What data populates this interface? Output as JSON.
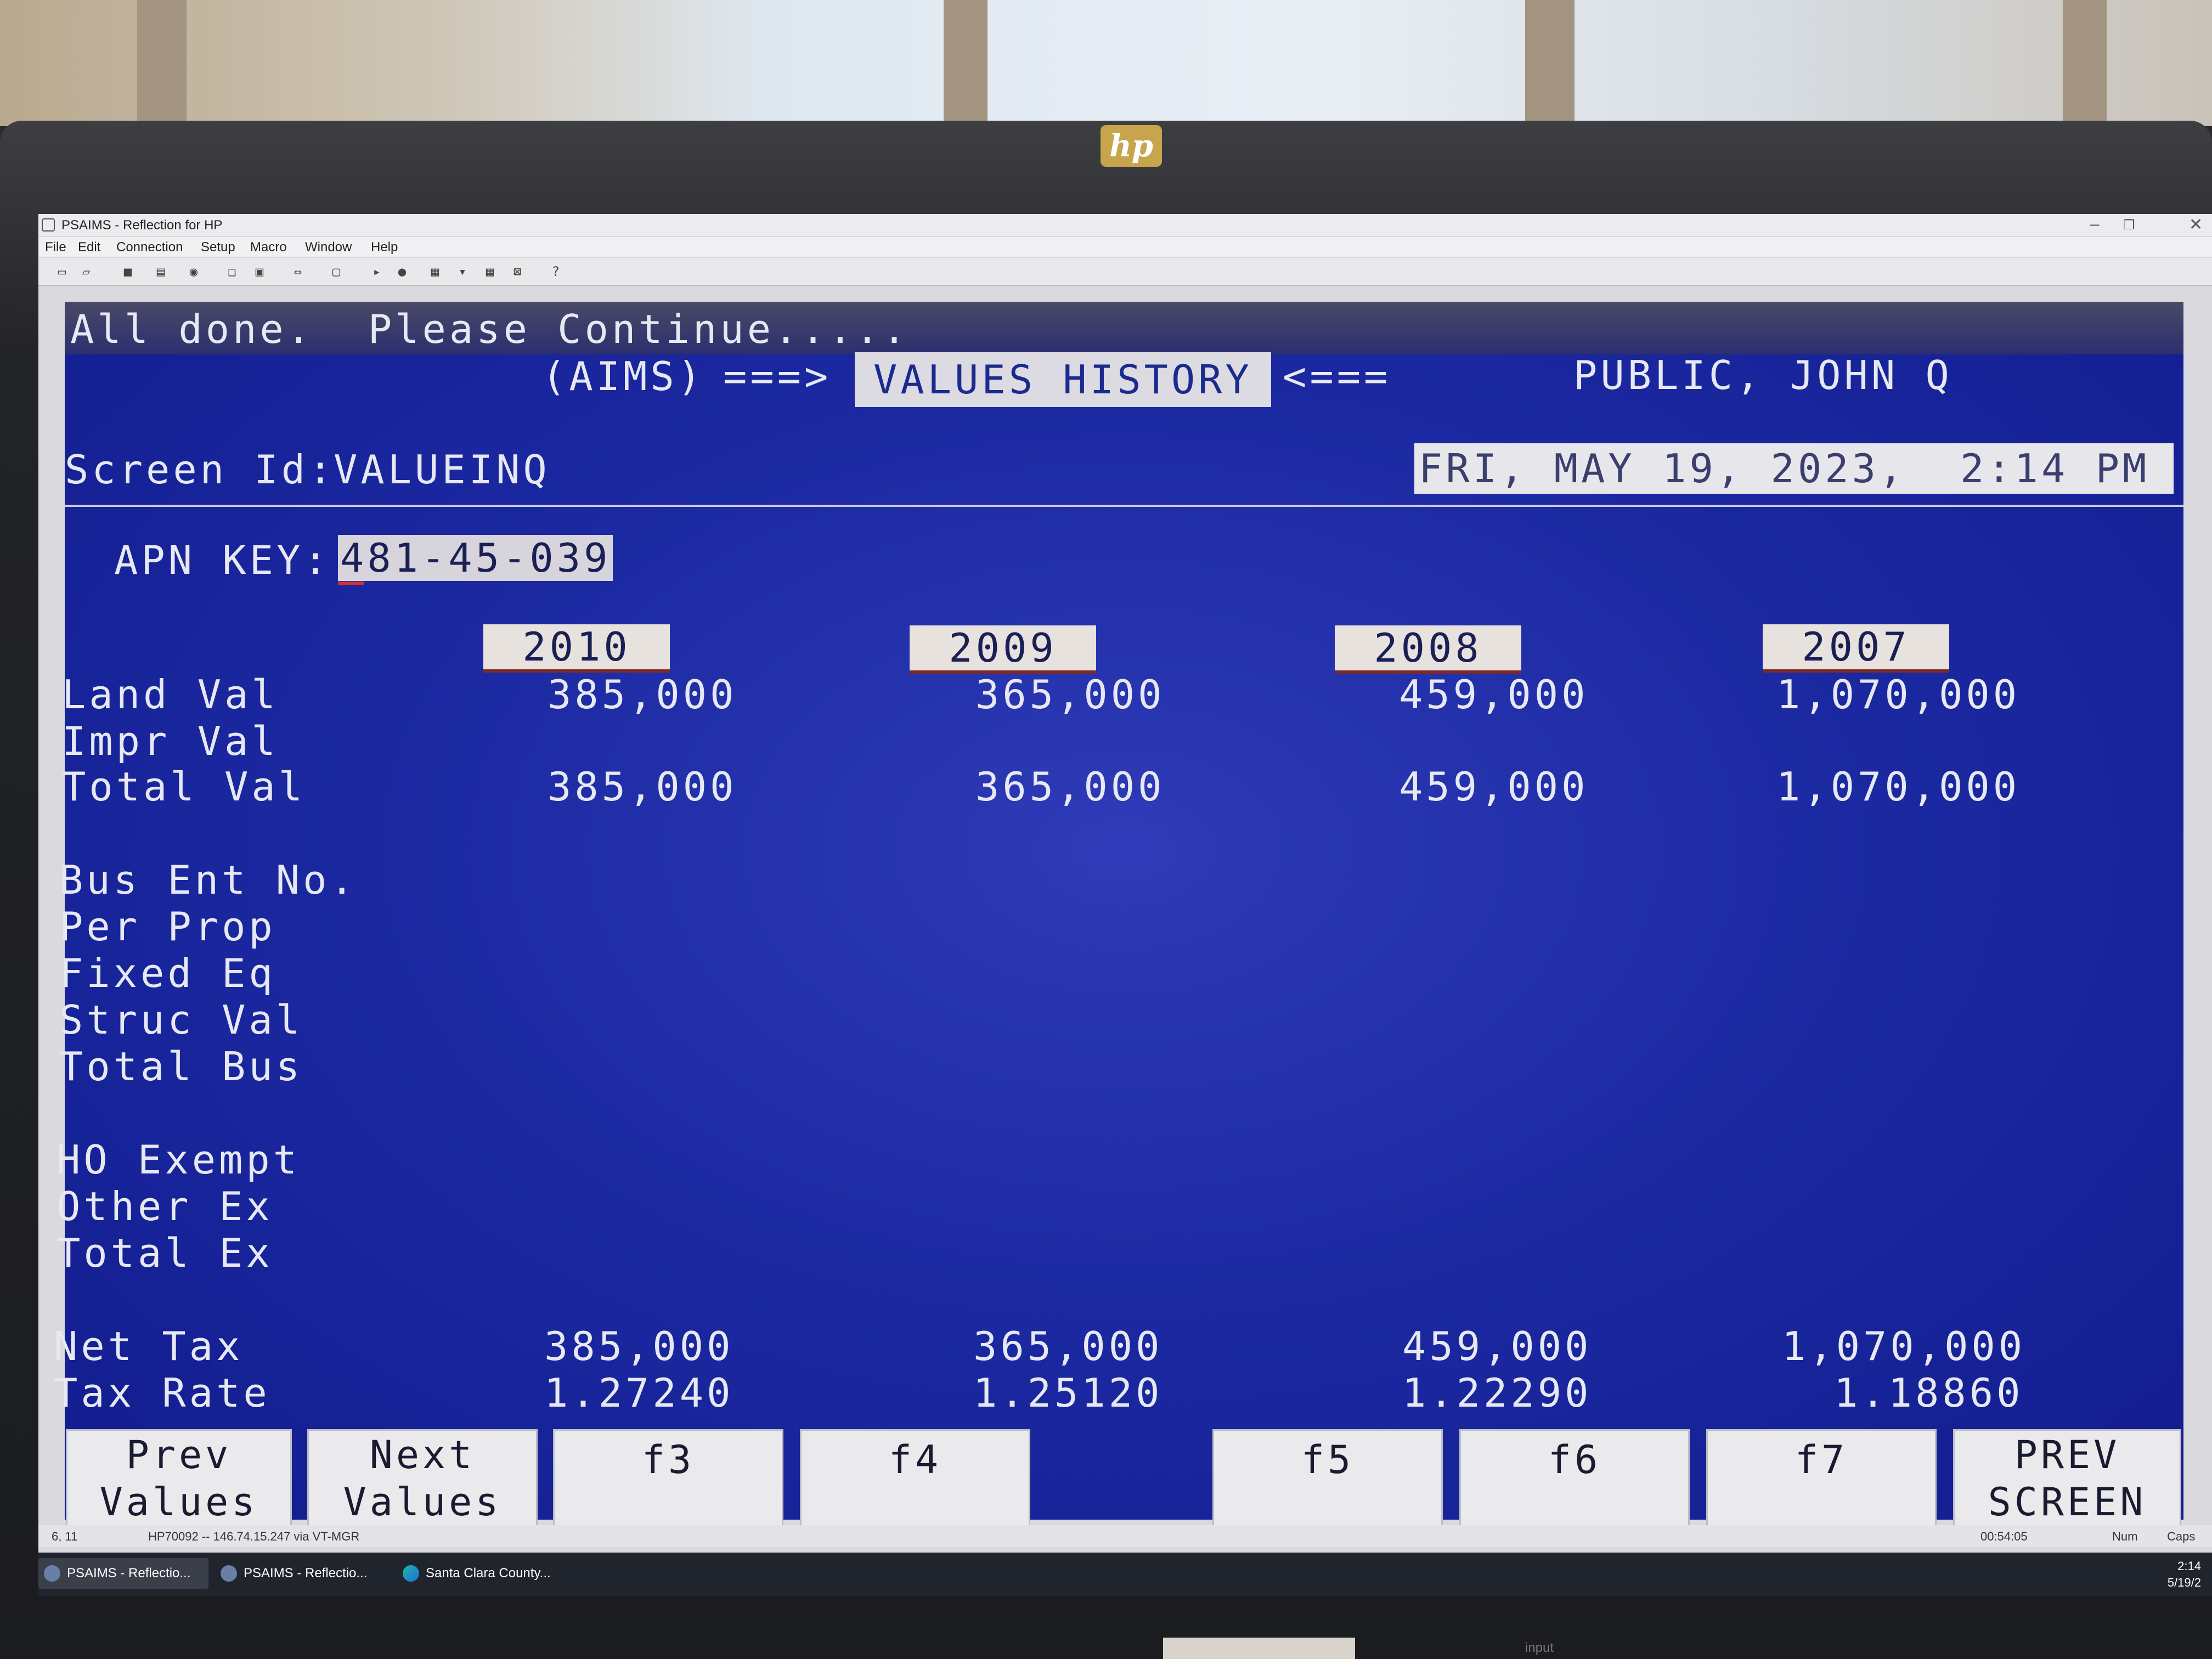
{
  "app": {
    "title": "PSAIMS - Reflection for HP",
    "menu": [
      "File",
      "Edit",
      "Connection",
      "Setup",
      "Macro",
      "Window",
      "Help"
    ]
  },
  "terminal": {
    "status_message": "All done.  Please Continue.....",
    "header": {
      "aims": "(AIMS)",
      "arrow_right": "===>",
      "screen_title": "VALUES HISTORY",
      "arrow_left": "<===",
      "owner": "PUBLIC, JOHN Q"
    },
    "screen_id_label": "Screen Id:",
    "screen_id": "VALUEINQ",
    "datetime": "FRI, MAY 19, 2023,  2:14 PM",
    "apn_label": "APN KEY:",
    "apn_value": "481-45-039",
    "years": [
      "2010",
      "2009",
      "2008",
      "2007"
    ],
    "rows": [
      {
        "label": "Land Val",
        "values": [
          "385,000",
          "365,000",
          "459,000",
          "1,070,000"
        ]
      },
      {
        "label": "Impr Val",
        "values": [
          "",
          "",
          "",
          ""
        ]
      },
      {
        "label": "Total Val",
        "values": [
          "385,000",
          "365,000",
          "459,000",
          "1,070,000"
        ]
      },
      {
        "label": "Bus Ent No.",
        "values": [
          "",
          "",
          "",
          ""
        ]
      },
      {
        "label": "Per Prop",
        "values": [
          "",
          "",
          "",
          ""
        ]
      },
      {
        "label": "Fixed Eq",
        "values": [
          "",
          "",
          "",
          ""
        ]
      },
      {
        "label": "Struc Val",
        "values": [
          "",
          "",
          "",
          ""
        ]
      },
      {
        "label": "Total Bus",
        "values": [
          "",
          "",
          "",
          ""
        ]
      },
      {
        "label": "HO Exempt",
        "values": [
          "",
          "",
          "",
          ""
        ]
      },
      {
        "label": "Other Ex",
        "values": [
          "",
          "",
          "",
          ""
        ]
      },
      {
        "label": "Total Ex",
        "values": [
          "",
          "",
          "",
          ""
        ]
      },
      {
        "label": "Net Tax",
        "values": [
          "385,000",
          "365,000",
          "459,000",
          "1,070,000"
        ]
      },
      {
        "label": "Tax Rate",
        "values": [
          "1.27240",
          "1.25120",
          "1.22290",
          "1.18860"
        ]
      }
    ],
    "fkeys": [
      {
        "line1": "Prev",
        "line2": "Values"
      },
      {
        "line1": "Next",
        "line2": "Values"
      },
      {
        "line1": "f3",
        "line2": ""
      },
      {
        "line1": "f4",
        "line2": ""
      },
      {
        "line1": "f5",
        "line2": ""
      },
      {
        "line1": "f6",
        "line2": ""
      },
      {
        "line1": "f7",
        "line2": ""
      },
      {
        "line1": "PREV",
        "line2": "SCREEN"
      }
    ]
  },
  "statusbar": {
    "cursor": "6, 11",
    "connection": "HP70092 -- 146.74.15.247 via VT-MGR",
    "timer": "00:54:05",
    "num": "Num",
    "caps": "Caps"
  },
  "taskbar": {
    "items": [
      "PSAIMS - Reflectio...",
      "PSAIMS - Reflectio...",
      "Santa Clara County..."
    ],
    "time": "2:14",
    "date": "5/19/2"
  },
  "monitor": {
    "brand": "hp",
    "stand_label": "input"
  }
}
